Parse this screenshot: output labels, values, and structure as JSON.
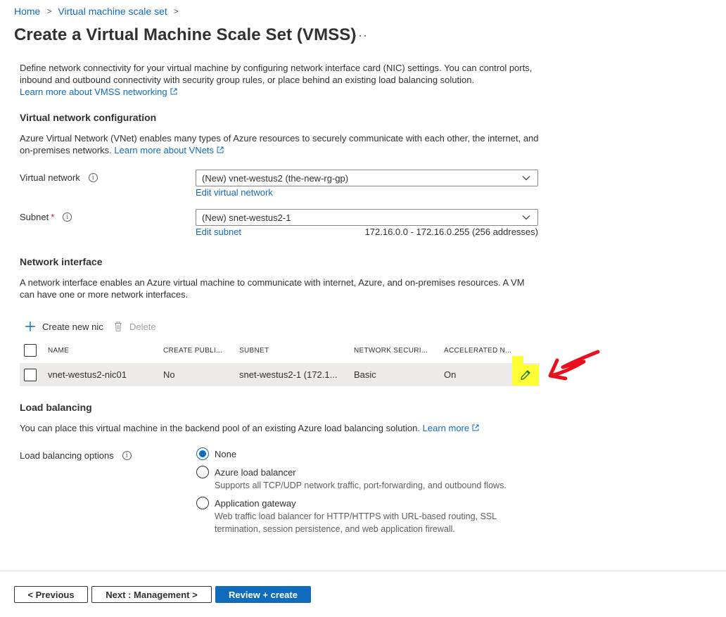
{
  "breadcrumb": {
    "home": "Home",
    "current": "Virtual machine scale set"
  },
  "page": {
    "title": "Create a Virtual Machine Scale Set (VMSS)",
    "more": "···"
  },
  "intro": {
    "text": "Define network connectivity for your virtual machine by configuring network interface card (NIC) settings. You can control ports, inbound and outbound connectivity with security group rules, or place behind an existing load balancing solution.",
    "link": "Learn more about VMSS networking"
  },
  "vnet_section": {
    "heading": "Virtual network configuration",
    "text": "Azure Virtual Network (VNet) enables many types of Azure resources to securely communicate with each other, the internet, and on-premises networks.",
    "link": "Learn more about VNets",
    "virtual_network": {
      "label": "Virtual network",
      "value": "(New) vnet-westus2 (the-new-rg-gp)",
      "edit_link": "Edit virtual network"
    },
    "subnet": {
      "label": "Subnet",
      "required": "*",
      "value": "(New) snet-westus2-1",
      "edit_link": "Edit subnet",
      "range": "172.16.0.0 - 172.16.0.255 (256 addresses)"
    }
  },
  "nic_section": {
    "heading": "Network interface",
    "text": "A network interface enables an Azure virtual machine to communicate with internet, Azure, and on-premises resources. A VM can have one or more network interfaces.",
    "toolbar": {
      "create": "Create new nic",
      "delete": "Delete"
    },
    "columns": [
      "NAME",
      "CREATE PUBLI...",
      "SUBNET",
      "NETWORK SECURI...",
      "ACCELERATED N..."
    ],
    "rows": [
      {
        "name": "vnet-westus2-nic01",
        "public_ip": "No",
        "subnet": "snet-westus2-1 (172.1...",
        "nsg": "Basic",
        "accelerated": "On"
      }
    ]
  },
  "lb_section": {
    "heading": "Load balancing",
    "text": "You can place this virtual machine in the backend pool of an existing Azure load balancing solution.",
    "link": "Learn more",
    "options_label": "Load balancing options",
    "options": [
      {
        "label": "None",
        "desc": "",
        "selected": true
      },
      {
        "label": "Azure load balancer",
        "desc": "Supports all TCP/UDP network traffic, port-forwarding, and outbound flows.",
        "selected": false
      },
      {
        "label": "Application gateway",
        "desc1": "Web traffic load balancer for HTTP/HTTPS with URL-based routing, SSL",
        "desc2": "termination, session persistence, and web application firewall.",
        "selected": false
      }
    ]
  },
  "footer": {
    "previous": "< Previous",
    "next": "Next : Management >",
    "review": "Review + create"
  },
  "colors": {
    "accent": "#0f6cbd",
    "highlight": "#ffff33",
    "annotation": "#e8101e"
  }
}
